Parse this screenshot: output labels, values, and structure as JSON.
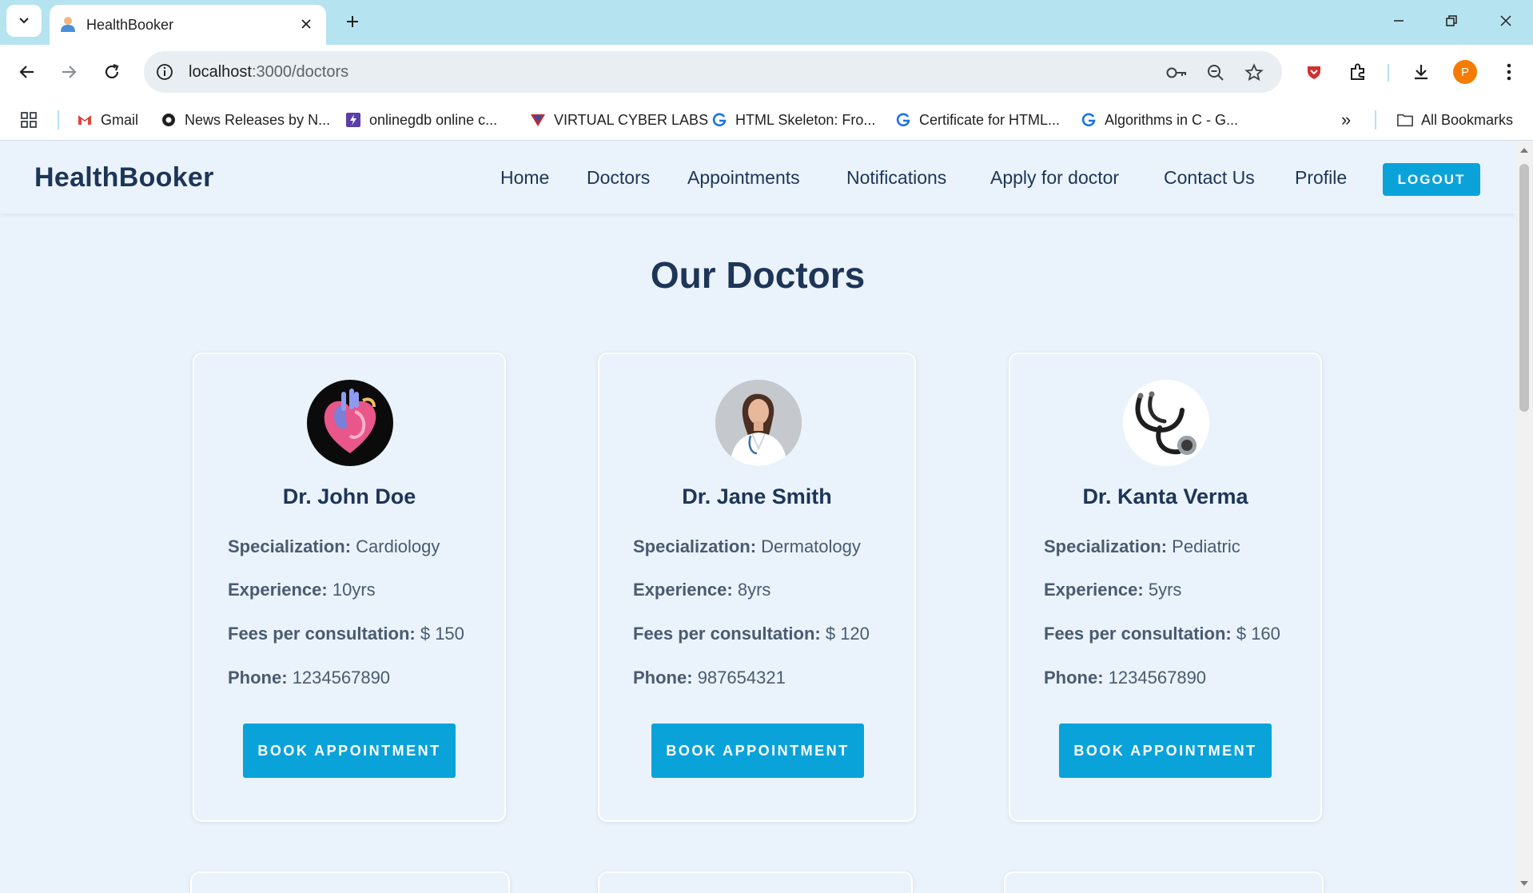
{
  "browser": {
    "tab_title": "HealthBooker",
    "url_host": "localhost",
    "url_path": ":3000/doctors",
    "profile_initial": "P",
    "bookmarks": [
      {
        "label": "Gmail",
        "icon": "gmail-icon"
      },
      {
        "label": "News Releases by N...",
        "icon": "news-icon"
      },
      {
        "label": "onlinegdb online c...",
        "icon": "onlinegdb-icon"
      },
      {
        "label": "VIRTUAL CYBER LABS",
        "icon": "cyber-labs-icon"
      },
      {
        "label": "HTML Skeleton: Fro...",
        "icon": "g-icon"
      },
      {
        "label": "Certificate for HTML...",
        "icon": "g-icon"
      },
      {
        "label": "Algorithms in C - G...",
        "icon": "g-icon"
      }
    ],
    "all_bookmarks": "All Bookmarks",
    "overflow": "»"
  },
  "site": {
    "brand": "HealthBooker",
    "nav": [
      "Home",
      "Doctors",
      "Appointments",
      "Notifications",
      "Apply for doctor",
      "Contact Us",
      "Profile"
    ],
    "logout": "LOGOUT"
  },
  "page": {
    "title": "Our Doctors",
    "labels": {
      "specialization": "Specialization:",
      "experience": "Experience:",
      "fees": "Fees per consultation:",
      "phone": "Phone:"
    },
    "book_label": "BOOK APPOINTMENT",
    "doctors": [
      {
        "name": "Dr. John Doe",
        "specialization": "Cardiology",
        "experience": "10yrs",
        "fees": "$ 150",
        "phone": "1234567890",
        "photo": "heart-illustration"
      },
      {
        "name": "Dr. Jane Smith",
        "specialization": "Dermatology",
        "experience": "8yrs",
        "fees": "$ 120",
        "phone": "987654321",
        "photo": "female-doctor-portrait"
      },
      {
        "name": "Dr. Kanta Verma",
        "specialization": "Pediatric",
        "experience": "5yrs",
        "fees": "$ 160",
        "phone": "1234567890",
        "photo": "stethoscope-illustration"
      }
    ]
  },
  "colors": {
    "tabbar": "#b5e3f0",
    "page_bg": "#eaf3fb",
    "brand_text": "#1d3557",
    "accent": "#0aa3d9"
  }
}
